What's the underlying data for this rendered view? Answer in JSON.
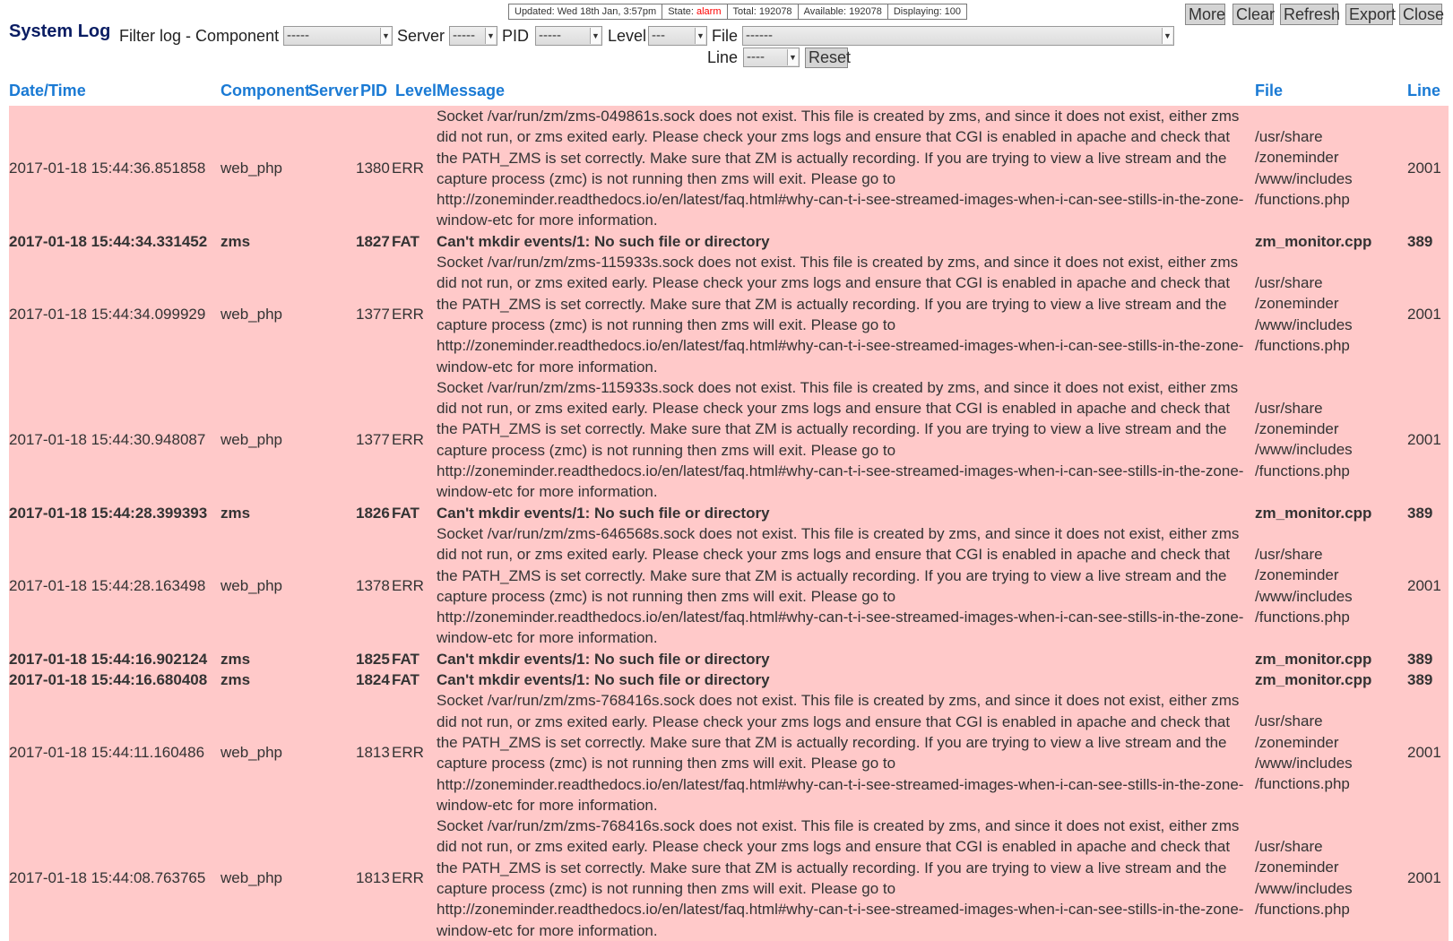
{
  "status": {
    "updated": "Updated: Wed 18th Jan, 3:57pm",
    "state_label": "State: ",
    "state_value": "alarm",
    "total": "Total: 192078",
    "available": "Available: 192078",
    "displaying": "Displaying: 100"
  },
  "title": "System Log",
  "filters": {
    "heading": "Filter log - Component",
    "component_value": "-----",
    "server_label": "Server",
    "server_value": "-----",
    "pid_label": "PID",
    "pid_value": "-----",
    "level_label": "Level",
    "level_value": "---",
    "file_label": "File",
    "file_value": "------",
    "line_label": "Line",
    "line_value": "----",
    "reset_label": "Reset"
  },
  "toolbar": {
    "more": "More",
    "clear": "Clear",
    "refresh": "Refresh",
    "export": "Export",
    "close": "Close"
  },
  "columns": {
    "datetime": "Date/Time",
    "component": "Component",
    "server": "Server",
    "pid": "PID",
    "level": "Level",
    "message": "Message",
    "file": "File",
    "line": "Line"
  },
  "rows": [
    {
      "datetime": "2017-01-18 15:44:36.851858",
      "component": "web_php",
      "pid": "1380",
      "level": "ERR",
      "message": "Socket /var/run/zm/zms-049861s.sock does not exist. This file is created by zms, and since it does not exist, either zms did not run, or zms exited early. Please check your zms logs and ensure that CGI is enabled in apache and check that the PATH_ZMS is set correctly. Make sure that ZM is actually recording. If you are trying to view a live stream and the capture process (zmc) is not running then zms will exit. Please go to http://zoneminder.readthedocs.io/en/latest/faq.html#why-can-t-i-see-streamed-images-when-i-can-see-stills-in-the-zone-window-etc for more information.",
      "file": [
        "/usr/share",
        "/zoneminder",
        "/www/includes",
        "/functions.php"
      ],
      "line": "2001"
    },
    {
      "datetime": "2017-01-18 15:44:34.331452",
      "component": "zms",
      "pid": "1827",
      "level": "FAT",
      "message": "Can't mkdir events/1: No such file or directory",
      "file": [
        "zm_monitor.cpp"
      ],
      "line": "389"
    },
    {
      "datetime": "2017-01-18 15:44:34.099929",
      "component": "web_php",
      "pid": "1377",
      "level": "ERR",
      "message": "Socket /var/run/zm/zms-115933s.sock does not exist. This file is created by zms, and since it does not exist, either zms did not run, or zms exited early. Please check your zms logs and ensure that CGI is enabled in apache and check that the PATH_ZMS is set correctly. Make sure that ZM is actually recording. If you are trying to view a live stream and the capture process (zmc) is not running then zms will exit. Please go to http://zoneminder.readthedocs.io/en/latest/faq.html#why-can-t-i-see-streamed-images-when-i-can-see-stills-in-the-zone-window-etc for more information.",
      "file": [
        "/usr/share",
        "/zoneminder",
        "/www/includes",
        "/functions.php"
      ],
      "line": "2001"
    },
    {
      "datetime": "2017-01-18 15:44:30.948087",
      "component": "web_php",
      "pid": "1377",
      "level": "ERR",
      "message": "Socket /var/run/zm/zms-115933s.sock does not exist. This file is created by zms, and since it does not exist, either zms did not run, or zms exited early. Please check your zms logs and ensure that CGI is enabled in apache and check that the PATH_ZMS is set correctly. Make sure that ZM is actually recording. If you are trying to view a live stream and the capture process (zmc) is not running then zms will exit. Please go to http://zoneminder.readthedocs.io/en/latest/faq.html#why-can-t-i-see-streamed-images-when-i-can-see-stills-in-the-zone-window-etc for more information.",
      "file": [
        "/usr/share",
        "/zoneminder",
        "/www/includes",
        "/functions.php"
      ],
      "line": "2001"
    },
    {
      "datetime": "2017-01-18 15:44:28.399393",
      "component": "zms",
      "pid": "1826",
      "level": "FAT",
      "message": "Can't mkdir events/1: No such file or directory",
      "file": [
        "zm_monitor.cpp"
      ],
      "line": "389"
    },
    {
      "datetime": "2017-01-18 15:44:28.163498",
      "component": "web_php",
      "pid": "1378",
      "level": "ERR",
      "message": "Socket /var/run/zm/zms-646568s.sock does not exist. This file is created by zms, and since it does not exist, either zms did not run, or zms exited early. Please check your zms logs and ensure that CGI is enabled in apache and check that the PATH_ZMS is set correctly. Make sure that ZM is actually recording. If you are trying to view a live stream and the capture process (zmc) is not running then zms will exit. Please go to http://zoneminder.readthedocs.io/en/latest/faq.html#why-can-t-i-see-streamed-images-when-i-can-see-stills-in-the-zone-window-etc for more information.",
      "file": [
        "/usr/share",
        "/zoneminder",
        "/www/includes",
        "/functions.php"
      ],
      "line": "2001"
    },
    {
      "datetime": "2017-01-18 15:44:16.902124",
      "component": "zms",
      "pid": "1825",
      "level": "FAT",
      "message": "Can't mkdir events/1: No such file or directory",
      "file": [
        "zm_monitor.cpp"
      ],
      "line": "389"
    },
    {
      "datetime": "2017-01-18 15:44:16.680408",
      "component": "zms",
      "pid": "1824",
      "level": "FAT",
      "message": "Can't mkdir events/1: No such file or directory",
      "file": [
        "zm_monitor.cpp"
      ],
      "line": "389"
    },
    {
      "datetime": "2017-01-18 15:44:11.160486",
      "component": "web_php",
      "pid": "1813",
      "level": "ERR",
      "message": "Socket /var/run/zm/zms-768416s.sock does not exist. This file is created by zms, and since it does not exist, either zms did not run, or zms exited early. Please check your zms logs and ensure that CGI is enabled in apache and check that the PATH_ZMS is set correctly. Make sure that ZM is actually recording. If you are trying to view a live stream and the capture process (zmc) is not running then zms will exit. Please go to http://zoneminder.readthedocs.io/en/latest/faq.html#why-can-t-i-see-streamed-images-when-i-can-see-stills-in-the-zone-window-etc for more information.",
      "file": [
        "/usr/share",
        "/zoneminder",
        "/www/includes",
        "/functions.php"
      ],
      "line": "2001"
    },
    {
      "datetime": "2017-01-18 15:44:08.763765",
      "component": "web_php",
      "pid": "1813",
      "level": "ERR",
      "message": "Socket /var/run/zm/zms-768416s.sock does not exist. This file is created by zms, and since it does not exist, either zms did not run, or zms exited early. Please check your zms logs and ensure that CGI is enabled in apache and check that the PATH_ZMS is set correctly. Make sure that ZM is actually recording. If you are trying to view a live stream and the capture process (zmc) is not running then zms will exit. Please go to http://zoneminder.readthedocs.io/en/latest/faq.html#why-can-t-i-see-streamed-images-when-i-can-see-stills-in-the-zone-window-etc for more information.",
      "file": [
        "/usr/share",
        "/zoneminder",
        "/www/includes",
        "/functions.php"
      ],
      "line": "2001"
    }
  ]
}
